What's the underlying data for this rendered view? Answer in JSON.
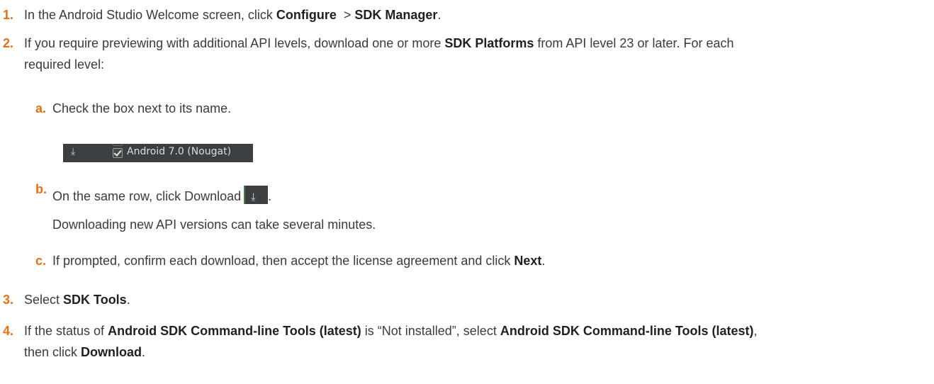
{
  "steps": [
    {
      "num": "1.",
      "pre": "In the Android Studio Welcome screen, click ",
      "b1": "Configure",
      "mid": "  > ",
      "b2": "SDK Manager",
      "post": "."
    },
    {
      "num": "2.",
      "pre": "If you require previewing with additional API levels, download one or more ",
      "b1": "SDK Platforms",
      "post_line1": " from API level 23 or later. For each",
      "line2": "required level:"
    },
    {
      "num": "3.",
      "pre": "Select ",
      "b1": "SDK Tools",
      "post": "."
    },
    {
      "num": "4.",
      "pre": "If the status of ",
      "b1": "Android SDK Command-line Tools (latest)",
      "mid": " is “Not installed”, select ",
      "b2": "Android SDK Command-line Tools (latest)",
      "post_line1": ",",
      "line2_pre": "then click ",
      "line2_b": "Download",
      "line2_post": "."
    }
  ],
  "substeps": [
    {
      "letter": "a.",
      "text": "Check the box next to its name."
    },
    {
      "letter": "b.",
      "text": "On the same row, click Download",
      "post": ".",
      "note": "Downloading new API versions can take several minutes."
    },
    {
      "letter": "c.",
      "pre": "If prompted, confirm each download, then accept the license agreement and click ",
      "b1": "Next",
      "post": "."
    }
  ],
  "screenshot": {
    "row_label": "Android 7.0 (Nougat)",
    "download_icon": "download-icon",
    "checkbox_state": "checked"
  },
  "icons": {
    "download_glyph": "⤓",
    "inline_download_icon": "download-icon"
  },
  "colors": {
    "step_number": "#e0701a",
    "text": "#3b3b3b",
    "screenshot_bg": "#3c3f41"
  }
}
